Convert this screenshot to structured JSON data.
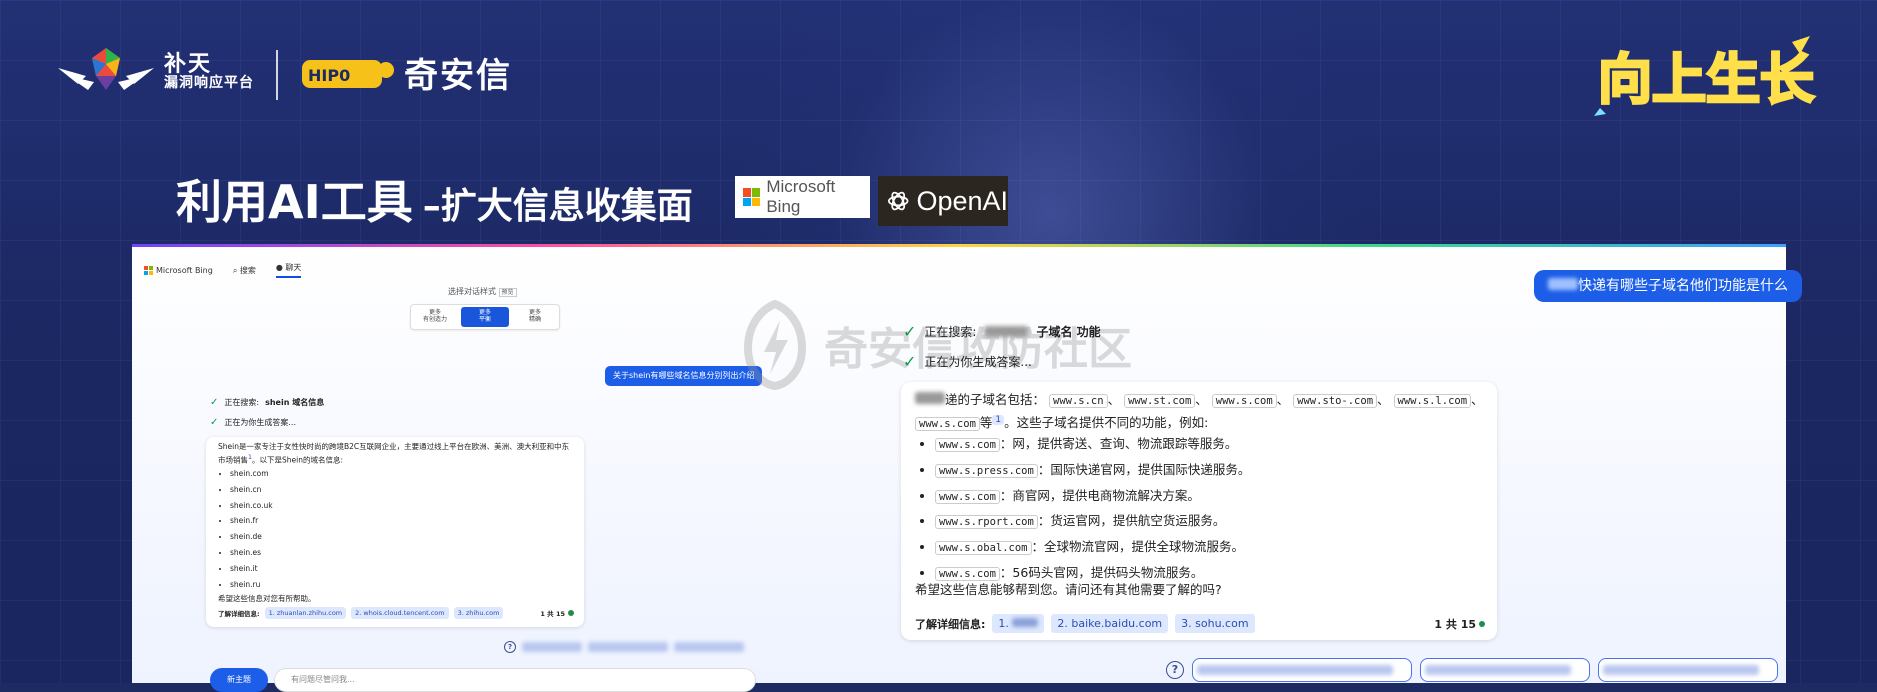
{
  "colors": {
    "background": "#1e2b63",
    "accent_blue": "#1d5ee8",
    "check_green": "#0f9a4a"
  },
  "header": {
    "logo_butian_line1": "补天",
    "logo_butian_line2": "漏洞响应平台",
    "logo_qianxin": "奇安信",
    "badge_text": "向上生长"
  },
  "title": {
    "main": "利用AI工具",
    "sub": "–扩大信息收集面",
    "bing_logo": "Microsoft Bing",
    "openai_logo": "OpenAI"
  },
  "watermark": "奇安信攻防社区",
  "left_chat": {
    "brand": "Microsoft Bing",
    "tab_search": "搜索",
    "tab_chat": "聊天",
    "style_label": "选择对话样式",
    "style_beta": "预览",
    "styles": [
      "更多\n有创造力",
      "更多\n平衡",
      "更多\n精确"
    ],
    "user_message": "关于shein有哪些域名信息分别列出介绍",
    "check_1_prefix": "正在搜索:",
    "check_1_query": "shein 域名信息",
    "check_2": "正在为你生成答案...",
    "answer_intro": "Shein是一家专注于女性快时尚的跨境B2C互联网企业，主要通过线上平台在欧洲、美洲、澳大利亚和中东市场销售",
    "answer_intro_2": "。以下是Shein的域名信息:",
    "domains": [
      "shein.com",
      "shein.cn",
      "shein.co.uk",
      "shein.fr",
      "shein.de",
      "shein.es",
      "shein.it",
      "shein.ru"
    ],
    "closing": "希望这些信息对您有所帮助。",
    "more_label": "了解详细信息:",
    "sources": [
      "1. zhuanlan.zhihu.com",
      "2. whois.cloud.tencent.com",
      "3. zhihu.com"
    ],
    "count": "1 共 15",
    "new_topic": "新主题",
    "input_placeholder": "有问题尽管问我..."
  },
  "right_chat": {
    "user_message": "快递有哪些子域名他们功能是什么",
    "check_1_prefix": "正在搜索:",
    "check_1_query": "子域名 功能",
    "check_2": "正在为你生成答案...",
    "intro_1": "递的子域名包括：",
    "intro_codes": [
      "www.s.cn",
      "www.st.com",
      "www.s.com",
      "www.sto-.com",
      "www.s.l.com",
      "www.s.com"
    ],
    "intro_2": "等",
    "intro_3": "。这些子域名提供不同的功能，例如:",
    "items": [
      {
        "code": "www.s.com",
        "text": "网，提供寄送、查询、物流跟踪等服务。"
      },
      {
        "code": "www.s.press.com",
        "text": "国际快递官网，提供国际快递服务。"
      },
      {
        "code": "www.s.com",
        "text": "商官网，提供电商物流解决方案。"
      },
      {
        "code": "www.s.rport.com",
        "text": "货运官网，提供航空货运服务。"
      },
      {
        "code": "www.s.obal.com",
        "text": "全球物流官网，提供全球物流服务。"
      },
      {
        "code": "www.s.com",
        "text": "56码头官网，提供码头物流服务。"
      }
    ],
    "closing": "希望这些信息能够帮到您。请问还有其他需要了解的吗?",
    "more_label": "了解详细信息:",
    "sources": [
      "1.",
      "2. baike.baidu.com",
      "3. sohu.com"
    ],
    "count": "1 共 15"
  }
}
